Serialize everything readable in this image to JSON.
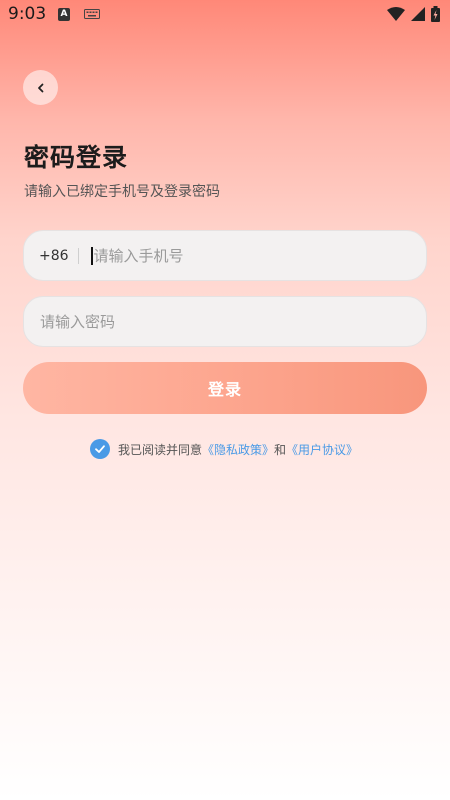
{
  "status_bar": {
    "time": "9:03",
    "notification_letter": "A"
  },
  "page": {
    "title": "密码登录",
    "subtitle": "请输入已绑定手机号及登录密码"
  },
  "phone": {
    "country_code": "+86",
    "placeholder": "请输入手机号",
    "value": ""
  },
  "password": {
    "placeholder": "请输入密码",
    "value": ""
  },
  "login_button": {
    "label": "登录"
  },
  "agreement": {
    "checked": true,
    "prefix": "我已阅读并同意",
    "privacy_link": "《隐私政策》",
    "connector": "和",
    "terms_link": "《用户协议》"
  },
  "colors": {
    "accent": "#4a9ae6",
    "button": "#fda68f",
    "header_gradient_top": "#ff8878"
  }
}
